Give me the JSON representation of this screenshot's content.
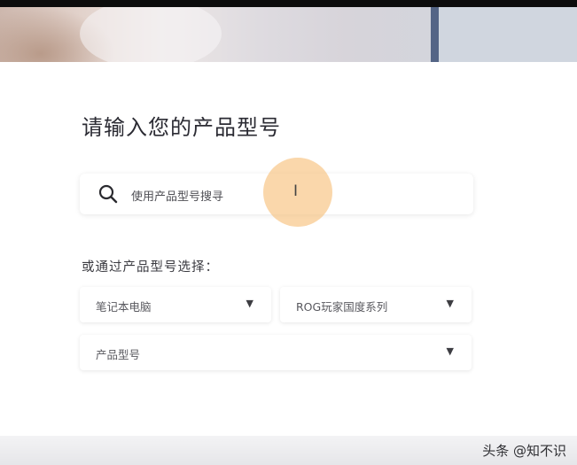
{
  "title": "请输入您的产品型号",
  "search": {
    "placeholder": "使用产品型号搜寻",
    "icon": "search-icon"
  },
  "select_prompt": "或通过产品型号选择：",
  "dropdowns": {
    "category": {
      "value": "笔记本电脑",
      "icon": "caret-down-icon"
    },
    "series": {
      "value": "ROG玩家国度系列",
      "icon": "caret-down-icon"
    },
    "model": {
      "value": "产品型号",
      "icon": "caret-down-icon"
    }
  },
  "watermark": "头条 @知不识",
  "colors": {
    "highlight": "#f7be78",
    "text": "#2b2b33"
  }
}
